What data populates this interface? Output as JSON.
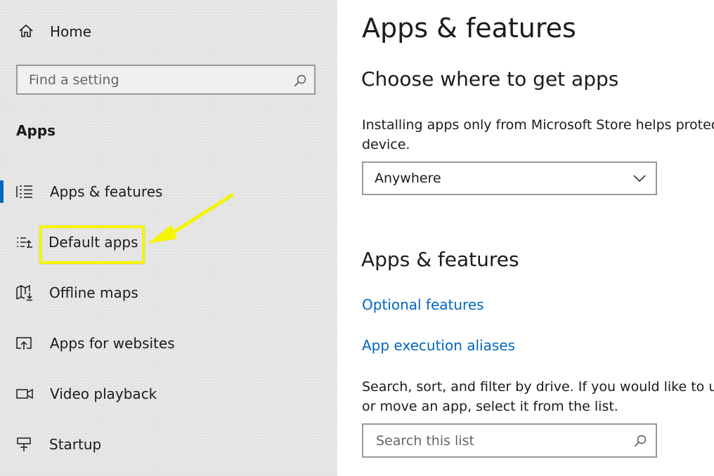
{
  "sidebar": {
    "home_label": "Home",
    "search_placeholder": "Find a setting",
    "section_title": "Apps",
    "items": [
      {
        "label": "Apps & features",
        "icon": "list-icon",
        "selected": true
      },
      {
        "label": "Default apps",
        "icon": "default-apps-icon",
        "selected": false
      },
      {
        "label": "Offline maps",
        "icon": "map-download-icon",
        "selected": false
      },
      {
        "label": "Apps for websites",
        "icon": "open-in-app-icon",
        "selected": false
      },
      {
        "label": "Video playback",
        "icon": "video-camera-icon",
        "selected": false
      },
      {
        "label": "Startup",
        "icon": "startup-icon",
        "selected": false
      }
    ]
  },
  "main": {
    "page_title": "Apps & features",
    "choose_heading": "Choose where to get apps",
    "install_text_line1": "Installing apps only from Microsoft Store helps protect",
    "install_text_line2": "device.",
    "dropdown_value": "Anywhere",
    "features_heading": "Apps & features",
    "link_optional": "Optional features",
    "link_aliases": "App execution aliases",
    "search_text_line1": "Search, sort, and filter by drive. If you would like to uni",
    "search_text_line2": "or move an app, select it from the list.",
    "search_placeholder": "Search this list"
  },
  "colors": {
    "accent": "#0067c0",
    "highlight": "#f5f500",
    "sidebar_bg": "#e6e6e6"
  }
}
